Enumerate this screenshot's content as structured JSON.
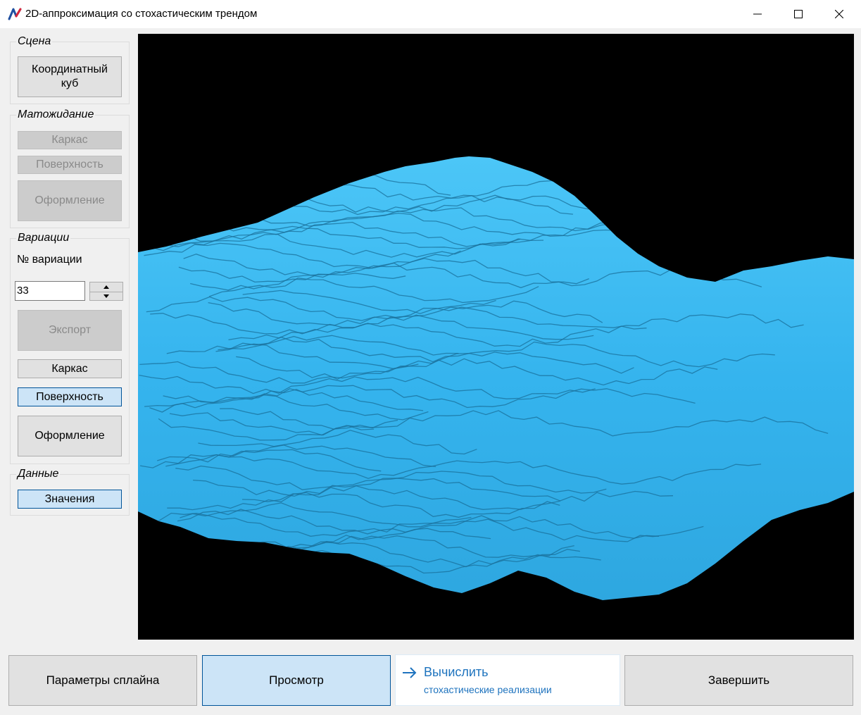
{
  "window": {
    "title": "2D-аппроксимация со стохастическим трендом",
    "controls": [
      "minimize",
      "maximize",
      "close"
    ]
  },
  "sidebar": {
    "scene": {
      "legend": "Сцена",
      "coord_cube_label": "Координатный\nкуб"
    },
    "expectation": {
      "legend": "Матожидание",
      "wireframe_label": "Каркас",
      "surface_label": "Поверхность",
      "styling_label": "Оформление",
      "enabled": false
    },
    "variations": {
      "legend": "Вариации",
      "number_label": "№ вариации",
      "number_value": "33",
      "export_label": "Экспорт",
      "wireframe_label": "Каркас",
      "surface_label": "Поверхность",
      "styling_label": "Оформление",
      "surface_selected": true
    },
    "data": {
      "legend": "Данные",
      "values_label": "Значения"
    }
  },
  "viewport": {
    "background": "#000000",
    "surface_color": "#3ab8f0",
    "ridge_color": "#1a6f99"
  },
  "bottom": {
    "spline_params_label": "Параметры сплайна",
    "view_label": "Просмотр",
    "compute_label": "Вычислить",
    "compute_sub_label": "стохастические реализации",
    "finish_label": "Завершить"
  },
  "colors": {
    "accent": "#1e73be",
    "selected_fill": "#cce4f7",
    "selected_border": "#005499"
  }
}
